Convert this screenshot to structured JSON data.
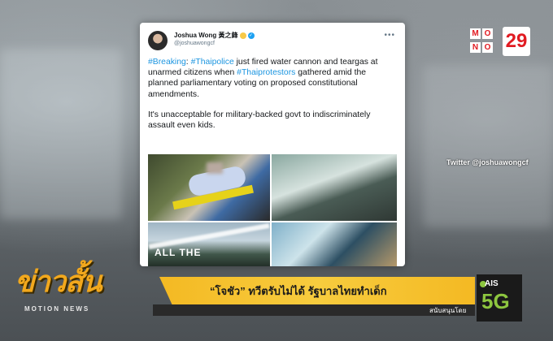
{
  "tweet": {
    "name": "Joshua Wong 黃之鋒",
    "handle": "@joshuawongcf",
    "more": "•••",
    "paragraph1_parts": [
      {
        "text": "#Breaking",
        "tag": true
      },
      {
        "text": ": ",
        "tag": false
      },
      {
        "text": "#Thaipolice",
        "tag": true
      },
      {
        "text": " just fired water cannon and teargas at unarmed citizens when ",
        "tag": false
      },
      {
        "text": "#Thaiprotestors",
        "tag": true
      },
      {
        "text": " gathered amid the planned parliamentary voting on proposed constitutional amendments.",
        "tag": false
      }
    ],
    "paragraph2": "It's unacceptable for military-backed govt to indiscriminately assault even kids.",
    "image_watermark": "ALL THE"
  },
  "broadcast": {
    "channel_logo_letters": [
      "M",
      "O",
      "N",
      "O"
    ],
    "channel_logo_number": "29",
    "credit": "Twitter @joshuawongcf",
    "show_title": "ข่าวสั้น",
    "show_subtitle": "MOTION NEWS",
    "headline": "“โจชัว” ทวีตรับไม่ได้ รัฐบาลไทยทำเด็ก",
    "sponsor_label": "สนับสนุนโดย",
    "sponsor_brand": "AIS",
    "sponsor_product": "5G"
  },
  "colors": {
    "accent_yellow": "#f4b923",
    "link_blue": "#1b95e0",
    "logo_red": "#e11b22",
    "ais_green": "#8dc63f"
  }
}
